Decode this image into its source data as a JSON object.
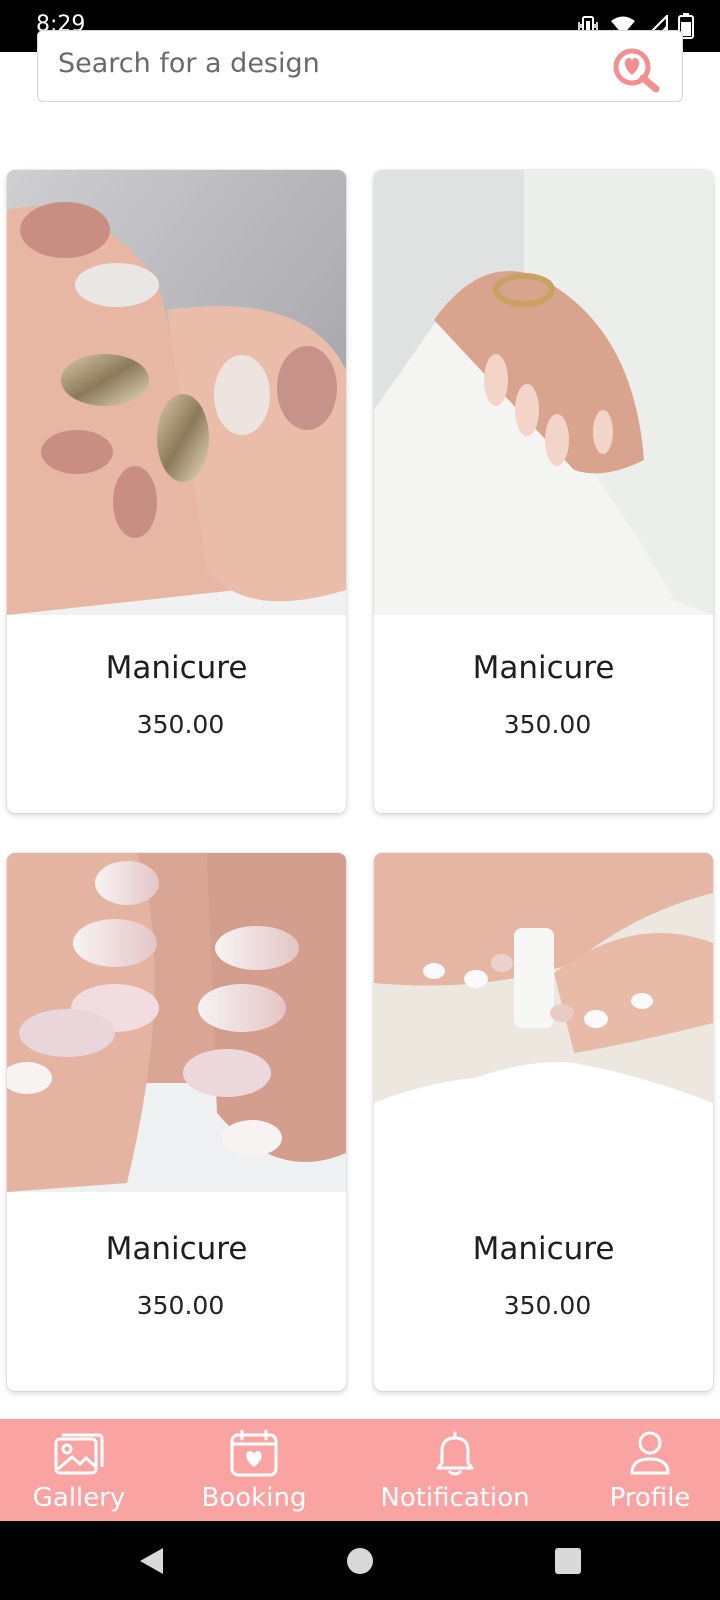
{
  "status_bar": {
    "time": "8:29",
    "icons": [
      "vibrate-icon",
      "wifi-icon",
      "signal-icon",
      "battery-icon"
    ]
  },
  "search": {
    "placeholder": "Search for a design",
    "icon": "heart-search-icon"
  },
  "designs": [
    {
      "title": "Manicure",
      "price": "350.00"
    },
    {
      "title": "Manicure",
      "price": "350.00"
    },
    {
      "title": "Manicure",
      "price": "350.00"
    },
    {
      "title": "Manicure",
      "price": "350.00"
    }
  ],
  "bottom_nav": {
    "items": [
      {
        "label": "Gallery",
        "icon": "gallery-icon"
      },
      {
        "label": "Booking",
        "icon": "calendar-heart-icon"
      },
      {
        "label": "Notification",
        "icon": "bell-icon"
      },
      {
        "label": "Profile",
        "icon": "person-icon"
      }
    ]
  },
  "system_nav": {
    "buttons": [
      "back-icon",
      "home-icon",
      "recents-icon"
    ]
  },
  "colors": {
    "accent": "#f9a3a3",
    "search_icon": "#f28f8f",
    "status_bar": "#000000"
  }
}
